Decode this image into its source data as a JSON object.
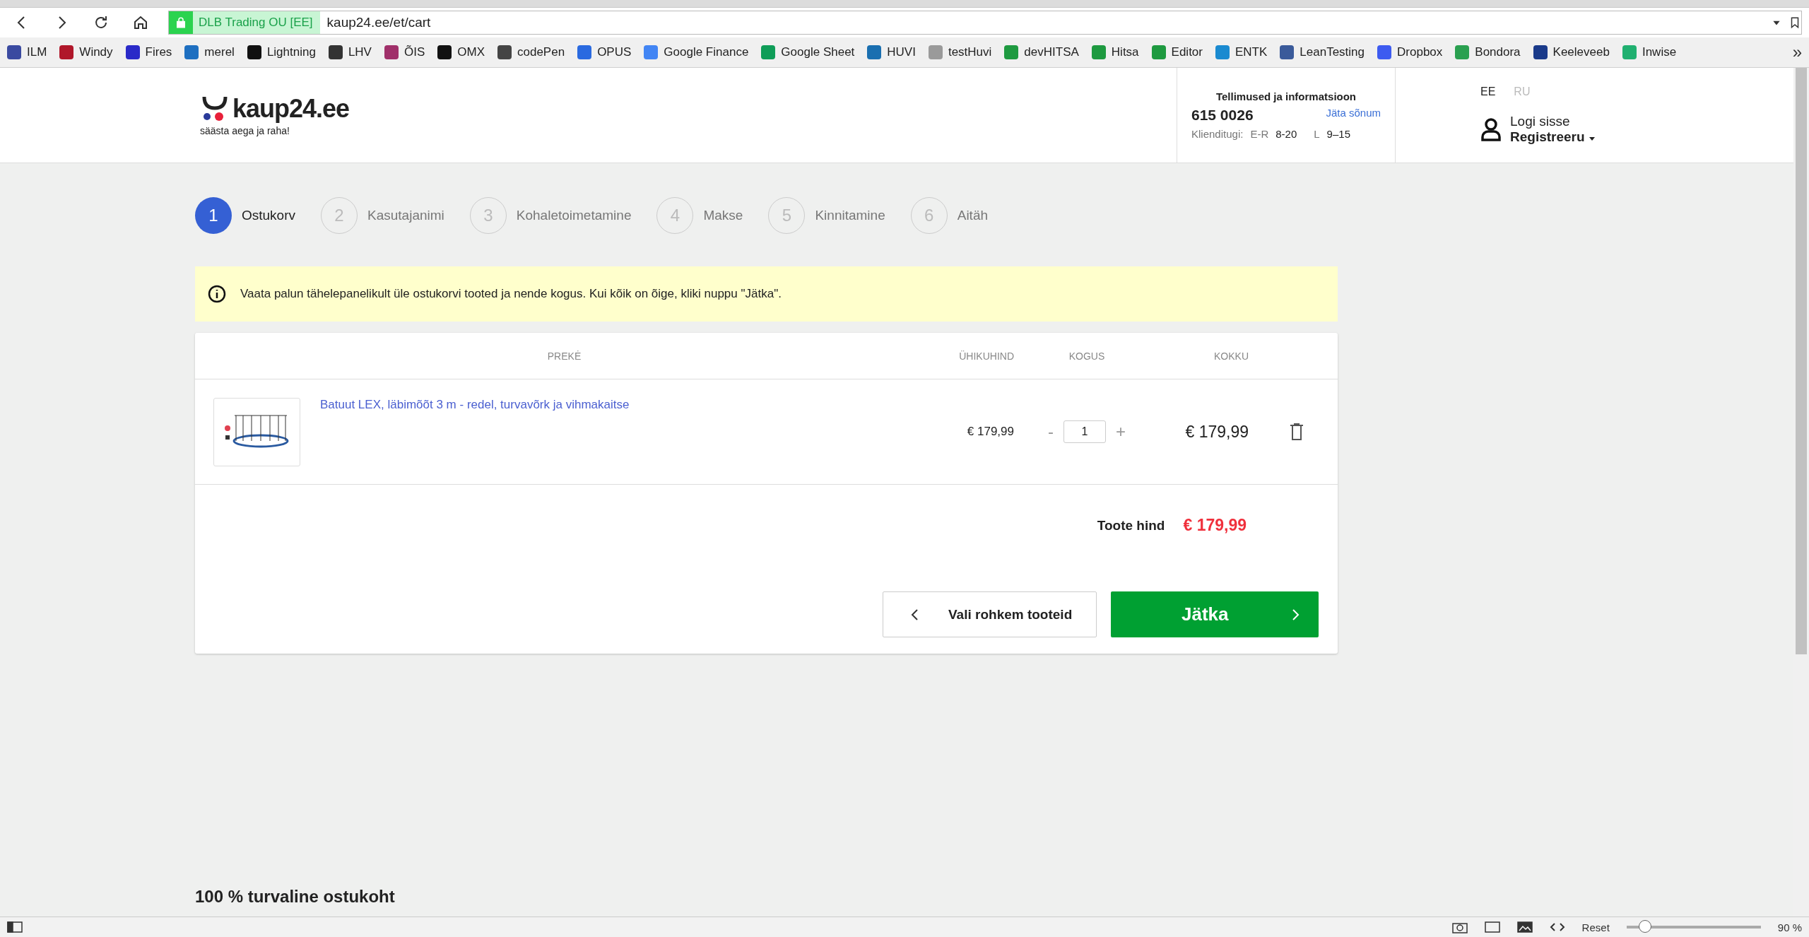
{
  "browser": {
    "identity": "DLB Trading OU [EE]",
    "url": "kaup24.ee/et/cart",
    "bookmarks": [
      {
        "label": "ILM",
        "color": "#3a4aa0"
      },
      {
        "label": "Windy",
        "color": "#b0172a"
      },
      {
        "label": "Fires",
        "color": "#2a2ac8"
      },
      {
        "label": "merel",
        "color": "#1e6fc0"
      },
      {
        "label": "Lightning",
        "color": "#111111"
      },
      {
        "label": "LHV",
        "color": "#333333"
      },
      {
        "label": "ÕIS",
        "color": "#a0306a"
      },
      {
        "label": "OMX",
        "color": "#111111"
      },
      {
        "label": "codePen",
        "color": "#444444"
      },
      {
        "label": "OPUS",
        "color": "#2a6ae0"
      },
      {
        "label": "Google Finance",
        "color": "#4285f4"
      },
      {
        "label": "Google Sheet",
        "color": "#0f9d58"
      },
      {
        "label": "HUVI",
        "color": "#1a6fb0"
      },
      {
        "label": "testHuvi",
        "color": "#9a9a9a"
      },
      {
        "label": "devHITSA",
        "color": "#1e9a40"
      },
      {
        "label": "Hitsa",
        "color": "#1e9a40"
      },
      {
        "label": "Editor",
        "color": "#1e9a40"
      },
      {
        "label": "ENTK",
        "color": "#1a8ad0"
      },
      {
        "label": "LeanTesting",
        "color": "#3a5a9a"
      },
      {
        "label": "Dropbox",
        "color": "#3d5bf0"
      },
      {
        "label": "Bondora",
        "color": "#2aa050"
      },
      {
        "label": "Keeleveeb",
        "color": "#1a3a8a"
      },
      {
        "label": "Inwise",
        "color": "#20b070"
      }
    ],
    "more": "»"
  },
  "header": {
    "logo": "kaup24.ee",
    "tagline": "säästa aega ja raha!",
    "info_title": "Tellimused ja informatsioon",
    "phone": "615 0026",
    "message_link": "Jäta sõnum",
    "support_label": "Klienditugi:",
    "hours": [
      {
        "days": "E-R",
        "time": "8-20"
      },
      {
        "days": "L",
        "time": "9–15"
      }
    ],
    "languages": [
      {
        "label": "EE",
        "selected": true
      },
      {
        "label": "RU",
        "selected": false
      }
    ],
    "login": "Logi sisse",
    "register": "Registreeru"
  },
  "steps": [
    {
      "number": "1",
      "label": "Ostukorv",
      "selected": true
    },
    {
      "number": "2",
      "label": "Kasutajanimi",
      "selected": false
    },
    {
      "number": "3",
      "label": "Kohaletoimetamine",
      "selected": false
    },
    {
      "number": "4",
      "label": "Makse",
      "selected": false
    },
    {
      "number": "5",
      "label": "Kinnitamine",
      "selected": false
    },
    {
      "number": "6",
      "label": "Aitäh",
      "selected": false
    }
  ],
  "notice": "Vaata palun tähelepanelikult üle ostukorvi tooted ja nende kogus. Kui kõik on õige, kliki nuppu \"Jätka\".",
  "cart": {
    "columns": [
      "PREKĖ",
      "ÜHIKUHIND",
      "KOGUS",
      "KOKKU"
    ],
    "rows": [
      {
        "name": "Batuut LEX, läbimõõt 3 m - redel, turvavõrk ja vihmakaitse",
        "unit_price": "€ 179,99",
        "minus": "-",
        "quantity": "1",
        "plus": "+",
        "total": "€ 179,99"
      }
    ],
    "total_label": "Toote hind",
    "total_value": "€ 179,99",
    "back_button": "Vali rohkem tooteid",
    "continue_button": "Jätka"
  },
  "footer_title": "100 % turvaline ostukoht",
  "status_bar": {
    "reset": "Reset",
    "zoom": {
      "level": 0.1
    },
    "zoom_text": "90 %"
  }
}
